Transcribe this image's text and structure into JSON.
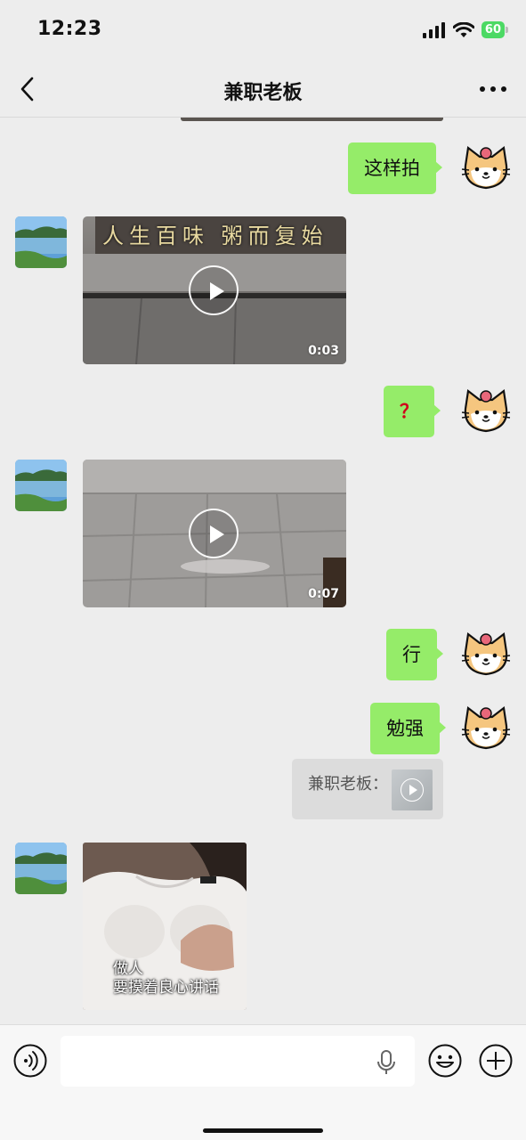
{
  "status_bar": {
    "time": "12:23",
    "battery": "60",
    "icons": [
      "signal-icon",
      "wifi-icon",
      "battery-icon"
    ]
  },
  "nav": {
    "title": "兼职老板",
    "back_icon": "chevron-left-icon",
    "more_icon": "more-icon"
  },
  "messages": {
    "m1": {
      "sender": "me",
      "type": "text",
      "text": "这样拍"
    },
    "m2": {
      "sender": "other",
      "type": "video",
      "duration": "0:03",
      "banner_text": "人生百味 粥而复始"
    },
    "m3": {
      "sender": "me",
      "type": "text",
      "text": "？"
    },
    "m4": {
      "sender": "other",
      "type": "video",
      "duration": "0:07"
    },
    "m5": {
      "sender": "me",
      "type": "text",
      "text": "行"
    },
    "m6": {
      "sender": "me",
      "type": "text",
      "text": "勉强"
    },
    "m7": {
      "sender": "me",
      "type": "quote",
      "text": "兼职老板："
    },
    "m8": {
      "sender": "other",
      "type": "image",
      "caption_line1": "做人",
      "caption_line2": "要摸着良心讲话"
    }
  },
  "input_bar": {
    "value": "",
    "icons": [
      "voice-icon",
      "microphone-icon",
      "emoji-icon",
      "plus-icon"
    ]
  },
  "colors": {
    "background": "#ededed",
    "my_bubble": "#95ec69",
    "battery": "#4cd964",
    "quote_bg": "#dcdcdc"
  }
}
